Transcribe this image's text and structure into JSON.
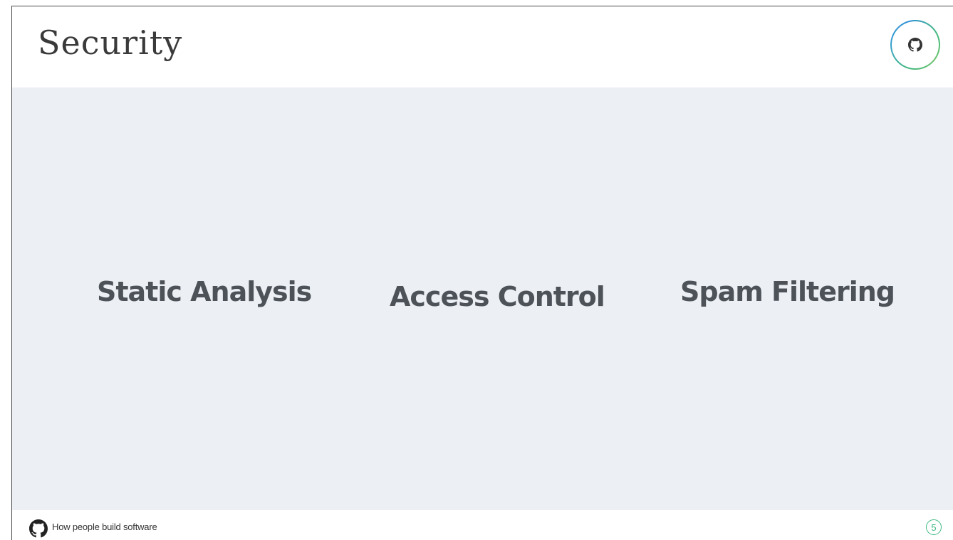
{
  "slide": {
    "title": "Security",
    "topics": [
      "Static Analysis",
      "Access Control",
      "Spam Filtering"
    ]
  },
  "footer": {
    "tagline": "How people build software",
    "page_number": "5"
  },
  "icons": {
    "header_badge": "github-octocat-icon",
    "footer_logo": "github-octocat-icon"
  },
  "colors": {
    "content_background": "#eceff4",
    "topic_text": "#4d5259",
    "accent_green": "#41b883",
    "accent_blue": "#2d8fd6"
  }
}
